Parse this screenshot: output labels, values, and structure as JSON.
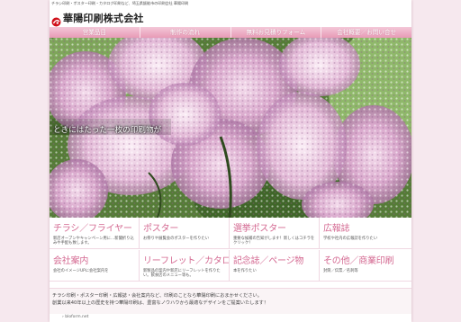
{
  "header": {
    "tagline": "チラシ印刷・ポスター印刷・カタログ印刷など、埼玉県飯能市の印刷会社 華陽印刷",
    "company_name": "華陽印刷株式会社"
  },
  "nav": {
    "items": [
      {
        "label": "営業品目"
      },
      {
        "label": "制作の流れ"
      },
      {
        "label": "無料お見積りフォーム"
      },
      {
        "label": "会社概要／お問い合せ"
      }
    ]
  },
  "hero": {
    "catch_copy": "ときにはたった一枚の印刷物が"
  },
  "products": [
    {
      "title": "チラシ／フライヤー",
      "desc": "新店オープンやキャンペーン用に…新聞折り込みや手配も致します。"
    },
    {
      "title": "ポスター",
      "desc": "お祭りや展覧会のポスターを作りたい"
    },
    {
      "title": "選挙ポスター",
      "desc": "重要な候補の告知がします！新しくはコチラをクリック！"
    },
    {
      "title": "広報誌",
      "desc": "学校や社内の広報誌を作りたい"
    },
    {
      "title": "会社案内",
      "desc": "会社のイメージUPに会社案内を"
    },
    {
      "title": "リーフレット／カタログ",
      "desc": "新製品の案内や新店にリーフレットを作りたい。飲食店のメニュー等も。"
    },
    {
      "title": "記念誌／ページ物",
      "desc": "本を作りたい"
    },
    {
      "title": "その他／商業印刷",
      "desc": "封筒／伝票／名刺等"
    }
  ],
  "info": {
    "line1": "チラシ印刷・ポスター印刷・広報誌・会社案内など、印刷のことなら華陽印刷におまかせください。",
    "line2": "創業以来40年以上の歴史を持つ華陽印刷は、豊富なノウハウから最適なデザインをご提案いたします！"
  },
  "footer": {
    "link_text": "› bloform.net"
  },
  "colors": {
    "accent_pink": "#d46a92",
    "nav_pink": "#e89ab6",
    "logo_red": "#d0101a"
  }
}
